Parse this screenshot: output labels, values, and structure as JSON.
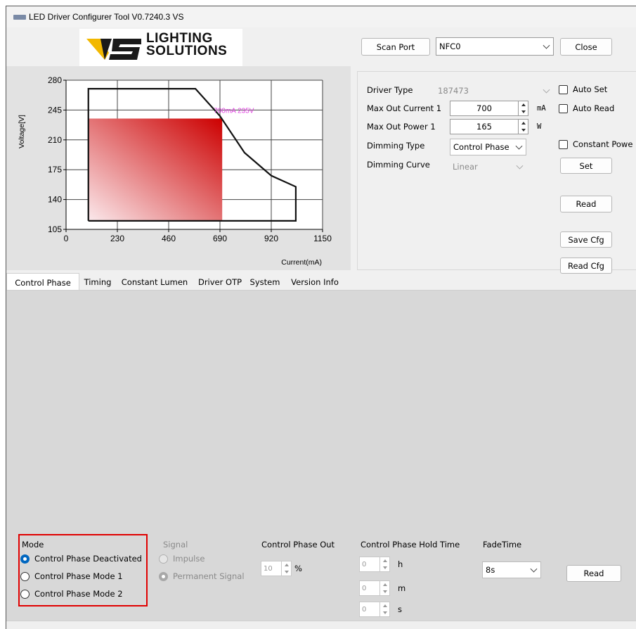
{
  "window": {
    "title": "LED Driver Configurer Tool V0.7240.3  VS"
  },
  "logo": {
    "line1": "LIGHTING",
    "line2": "SOLUTIONS"
  },
  "port": {
    "scan_label": "Scan Port",
    "port_value": "NFC0",
    "close_label": "Close"
  },
  "chart_data": {
    "type": "area",
    "xlabel": "Current(mA)",
    "ylabel": "Voltage[V]",
    "xlim": [
      0,
      1150
    ],
    "ylim": [
      105,
      280
    ],
    "xticks": [
      "0",
      "230",
      "460",
      "690",
      "920",
      "1150"
    ],
    "yticks": [
      "280",
      "245",
      "210",
      "175",
      "140",
      "105"
    ],
    "grid": true,
    "envelope": [
      [
        100,
        115
      ],
      [
        100,
        270
      ],
      [
        580,
        270
      ],
      [
        690,
        238
      ],
      [
        800,
        195
      ],
      [
        920,
        168
      ],
      [
        1030,
        155
      ],
      [
        1030,
        115
      ],
      [
        100,
        115
      ]
    ],
    "operating_point": {
      "current_mA": 700,
      "voltage_V": 235,
      "label": "700mA 235V"
    },
    "operating_area": {
      "x_from": 100,
      "x_to": 700,
      "y_from": 115,
      "y_to": 235
    }
  },
  "settings": {
    "driver_type_label": "Driver Type",
    "driver_type_value": "187473",
    "max_current_label": "Max Out Current 1",
    "max_current_value": "700",
    "max_current_unit": "mA",
    "max_power_label": "Max Out Power 1",
    "max_power_value": "165",
    "max_power_unit": "W",
    "dimming_type_label": "Dimming Type",
    "dimming_type_value": "Control Phase",
    "dimming_curve_label": "Dimming Curve",
    "dimming_curve_value": "Linear",
    "auto_set_label": "Auto Set",
    "auto_read_label": "Auto Read",
    "constant_power_label": "Constant Powe",
    "set_label": "Set",
    "read_label": "Read",
    "save_cfg_label": "Save Cfg",
    "read_cfg_label": "Read Cfg"
  },
  "tabs": [
    {
      "label": "Control Phase"
    },
    {
      "label": "Timing"
    },
    {
      "label": "Constant Lumen"
    },
    {
      "label": "Driver OTP"
    },
    {
      "label": "System"
    },
    {
      "label": "Version Info"
    }
  ],
  "control_phase": {
    "mode_label": "Mode",
    "modes": [
      "Control Phase Deactivated",
      "Control Phase Mode 1",
      "Control Phase Mode 2"
    ],
    "signal_label": "Signal",
    "signals": [
      "Impulse",
      "Permanent Signal"
    ],
    "out_label": "Control Phase Out",
    "out_value": "10",
    "out_unit": "%",
    "hold_label": "Control Phase Hold Time",
    "hold_h_value": "0",
    "hold_h_unit": "h",
    "hold_m_value": "0",
    "hold_m_unit": "m",
    "hold_s_value": "0",
    "hold_s_unit": "s",
    "fade_label": "FadeTime",
    "fade_value": "8s",
    "read_label": "Read"
  },
  "colors": {
    "selected_radio": "#0067c0",
    "highlight_box": "#e00000",
    "operating_area": "#cc0000",
    "point_label": "#e040e0"
  }
}
